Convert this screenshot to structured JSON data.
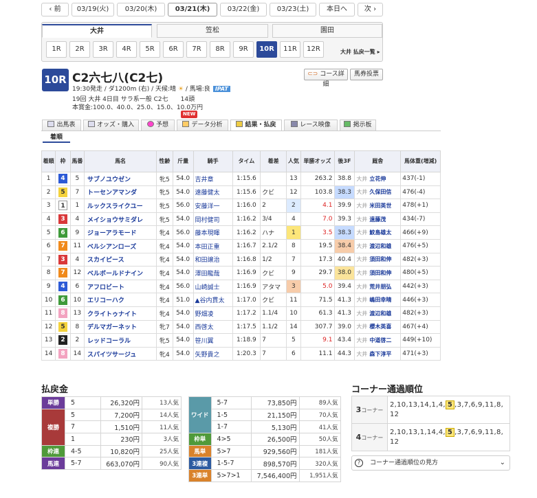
{
  "date_nav": {
    "prev": "前",
    "dates": [
      "03/19(火)",
      "03/20(木)",
      "03/21(木)",
      "03/22(金)",
      "03/23(土)"
    ],
    "today": "本日へ",
    "next": "次"
  },
  "venues": [
    "大井",
    "笠松",
    "園田"
  ],
  "races": [
    "1R",
    "2R",
    "3R",
    "4R",
    "5R",
    "6R",
    "7R",
    "8R",
    "9R",
    "10R",
    "11R",
    "12R"
  ],
  "race_list_link": "大井 払戻一覧",
  "race": {
    "number": "10R",
    "name": "C2六七八(C2七)",
    "line1": "19:30発走 / ダ1200m (右) / 天候:晴",
    "line1b": "/ 馬場:良",
    "ipat": "IPAT",
    "line2": "19回 大井 4日目 サラ系一般 C2七　　14頭",
    "line3": "本賞金:100.0、40.0、25.0、15.0、10.0万円"
  },
  "buttons": {
    "course": "コース詳細",
    "vote": "馬券投票"
  },
  "nav_tabs": [
    "出馬表",
    "オッズ・購入",
    "予想",
    "データ分析",
    "結果・払戻",
    "レース映像",
    "掲示板"
  ],
  "new_badge": "NEW",
  "sub_tab": "着順",
  "results": {
    "headers": [
      "着順",
      "枠",
      "馬番",
      "馬名",
      "性齢",
      "斤量",
      "騎手",
      "タイム",
      "着差",
      "人気",
      "単勝オッズ",
      "後3F",
      "厩舎",
      "馬体重(増減)"
    ],
    "rows": [
      {
        "pos": "1",
        "waku": "4",
        "num": "5",
        "name": "サブノユウゼン",
        "sex": "牝5",
        "wt": "54.0",
        "jockey": "吉井章",
        "time": "1:15.6",
        "margin": "",
        "pop": "13",
        "odds": "263.2",
        "f3": "38.8",
        "area": "大井",
        "trainer": "立花伸",
        "body": "437(-1)"
      },
      {
        "pos": "2",
        "waku": "5",
        "num": "7",
        "name": "トーセンアマンダ",
        "sex": "牝5",
        "wt": "54.0",
        "jockey": "遠藤健太",
        "time": "1:15.6",
        "margin": "クビ",
        "pop": "12",
        "odds": "103.8",
        "f3": "38.3",
        "area": "大井",
        "trainer": "久保田信",
        "body": "476(-4)"
      },
      {
        "pos": "3",
        "waku": "1",
        "num": "1",
        "name": "ルックスライクユー",
        "sex": "牝5",
        "wt": "56.0",
        "jockey": "安藤洋一",
        "time": "1:16.0",
        "margin": "2",
        "pop": "2",
        "odds": "4.1",
        "f3": "39.9",
        "area": "大井",
        "trainer": "米田英世",
        "body": "478(+1)"
      },
      {
        "pos": "4",
        "waku": "3",
        "num": "4",
        "name": "メイショウサミダレ",
        "sex": "牝5",
        "wt": "54.0",
        "jockey": "岡村健司",
        "time": "1:16.2",
        "margin": "3/4",
        "pop": "4",
        "odds": "7.0",
        "f3": "39.3",
        "area": "大井",
        "trainer": "遠藤茂",
        "body": "434(-7)"
      },
      {
        "pos": "5",
        "waku": "6",
        "num": "9",
        "name": "ジョーアラモード",
        "sex": "牝4",
        "wt": "56.0",
        "jockey": "藤本現暉",
        "time": "1:16.2",
        "margin": "ハナ",
        "pop": "1",
        "odds": "3.5",
        "f3": "38.3",
        "area": "大井",
        "trainer": "鮫島雄太",
        "body": "466(+9)"
      },
      {
        "pos": "6",
        "waku": "7",
        "num": "11",
        "name": "ベルシアンローズ",
        "sex": "牝4",
        "wt": "54.0",
        "jockey": "本田正重",
        "time": "1:16.7",
        "margin": "2.1/2",
        "pop": "8",
        "odds": "19.5",
        "f3": "38.4",
        "area": "大井",
        "trainer": "渡辺和雄",
        "body": "476(+5)"
      },
      {
        "pos": "7",
        "waku": "3",
        "num": "4",
        "name": "スカイピース",
        "sex": "牝4",
        "wt": "54.0",
        "jockey": "和田譲治",
        "time": "1:16.8",
        "margin": "1/2",
        "pop": "7",
        "odds": "17.3",
        "f3": "40.4",
        "area": "大井",
        "trainer": "須田和伸",
        "body": "482(+3)"
      },
      {
        "pos": "8",
        "waku": "7",
        "num": "12",
        "name": "ベルボールドナイン",
        "sex": "牝4",
        "wt": "54.0",
        "jockey": "澤田龍哉",
        "time": "1:16.9",
        "margin": "クビ",
        "pop": "9",
        "odds": "29.7",
        "f3": "38.0",
        "area": "大井",
        "trainer": "須田和伸",
        "body": "480(+5)"
      },
      {
        "pos": "9",
        "waku": "4",
        "num": "6",
        "name": "アフロビート",
        "sex": "牝4",
        "wt": "56.0",
        "jockey": "山崎誠士",
        "time": "1:16.9",
        "margin": "アタマ",
        "pop": "3",
        "odds": "5.0",
        "f3": "39.4",
        "area": "大井",
        "trainer": "荒井朋弘",
        "body": "442(+3)"
      },
      {
        "pos": "10",
        "waku": "6",
        "num": "10",
        "name": "エリコーハク",
        "sex": "牝4",
        "wt": "51.0",
        "jockey": "▲谷内貫太",
        "time": "1:17.0",
        "margin": "クビ",
        "pop": "11",
        "odds": "71.5",
        "f3": "41.3",
        "area": "大井",
        "trainer": "嶋田幸晴",
        "body": "446(+3)"
      },
      {
        "pos": "11",
        "waku": "8",
        "num": "13",
        "name": "クライトゥナイト",
        "sex": "牝4",
        "wt": "54.0",
        "jockey": "野畑凌",
        "time": "1:17.2",
        "margin": "1.1/4",
        "pop": "10",
        "odds": "61.3",
        "f3": "41.3",
        "area": "大井",
        "trainer": "渡辺和雄",
        "body": "482(+3)"
      },
      {
        "pos": "12",
        "waku": "5",
        "num": "8",
        "name": "デルマガーネット",
        "sex": "牝7",
        "wt": "54.0",
        "jockey": "西啓太",
        "time": "1:17.5",
        "margin": "1.1/2",
        "pop": "14",
        "odds": "307.7",
        "f3": "39.0",
        "area": "大井",
        "trainer": "櫻木英喜",
        "body": "467(+4)"
      },
      {
        "pos": "13",
        "waku": "2",
        "num": "2",
        "name": "レッドコーラル",
        "sex": "牝5",
        "wt": "54.0",
        "jockey": "笹川翼",
        "time": "1:18.9",
        "margin": "7",
        "pop": "5",
        "odds": "9.1",
        "f3": "43.4",
        "area": "大井",
        "trainer": "中道啓二",
        "body": "449(+10)"
      },
      {
        "pos": "14",
        "waku": "8",
        "num": "14",
        "name": "スパイツサージュ",
        "sex": "牝4",
        "wt": "54.0",
        "jockey": "矢野貴之",
        "time": "1:20.3",
        "margin": "7",
        "pop": "6",
        "odds": "11.1",
        "f3": "44.3",
        "area": "大井",
        "trainer": "森下淳平",
        "body": "471(+3)"
      }
    ]
  },
  "payout": {
    "title": "払戻金",
    "left": [
      {
        "label": "単勝",
        "color": "#6b3c9a",
        "rows": [
          {
            "comb": "5",
            "yen": "26,320円",
            "pop": "13人気"
          }
        ]
      },
      {
        "label": "複勝",
        "color": "#a83a3a",
        "rows": [
          {
            "comb": "5",
            "yen": "7,200円",
            "pop": "14人気"
          },
          {
            "comb": "7",
            "yen": "1,510円",
            "pop": "11人気"
          },
          {
            "comb": "1",
            "yen": "230円",
            "pop": "3人気"
          }
        ]
      },
      {
        "label": "枠連",
        "color": "#4f9a3a",
        "rows": [
          {
            "comb": "4-5",
            "yen": "10,820円",
            "pop": "25人気"
          }
        ]
      },
      {
        "label": "馬連",
        "color": "#6b3c9a",
        "rows": [
          {
            "comb": "5-7",
            "yen": "663,070円",
            "pop": "90人気"
          }
        ]
      }
    ],
    "right": [
      {
        "label": "ワイド",
        "color": "#5a9aa8",
        "rows": [
          {
            "comb": "5-7",
            "yen": "73,850円",
            "pop": "89人気"
          },
          {
            "comb": "1-5",
            "yen": "21,150円",
            "pop": "70人気"
          },
          {
            "comb": "1-7",
            "yen": "5,130円",
            "pop": "41人気"
          }
        ]
      },
      {
        "label": "枠単",
        "color": "#4f9a3a",
        "rows": [
          {
            "comb": "4>5",
            "yen": "26,500円",
            "pop": "50人気"
          }
        ]
      },
      {
        "label": "馬単",
        "color": "#d9822b",
        "rows": [
          {
            "comb": "5>7",
            "yen": "929,560円",
            "pop": "181人気"
          }
        ]
      },
      {
        "label": "3連複",
        "color": "#2c5aa0",
        "rows": [
          {
            "comb": "1-5-7",
            "yen": "898,570円",
            "pop": "320人気"
          }
        ]
      },
      {
        "label": "3連単",
        "color": "#d9822b",
        "rows": [
          {
            "comb": "5>7>1",
            "yen": "7,546,400円",
            "pop": "1,951人気"
          }
        ]
      }
    ]
  },
  "corner": {
    "title": "コーナー通過順位",
    "rows": [
      {
        "num": "3",
        "label": "コーナー",
        "line1": "2,10,13,14,1,4,",
        "hl": "5",
        "line1b": ",3,7,6,9,11,8,",
        "line2": "12"
      },
      {
        "num": "4",
        "label": "コーナー",
        "line1": "2,10,13,1,14,4,",
        "hl": "5",
        "line1b": ",3,7,6,9,11,8,",
        "line2": "12"
      }
    ],
    "help": "コーナー通過順位の見方"
  },
  "colors": {
    "waku1": "#ffffff",
    "waku2": "#222222",
    "waku3": "#d9383a",
    "waku4": "#2c5ad6",
    "waku5": "#f4d23c",
    "waku6": "#3f9a3a",
    "waku7": "#f08a1c",
    "waku8": "#f3a3c0",
    "accent": "#2c4a9a"
  }
}
